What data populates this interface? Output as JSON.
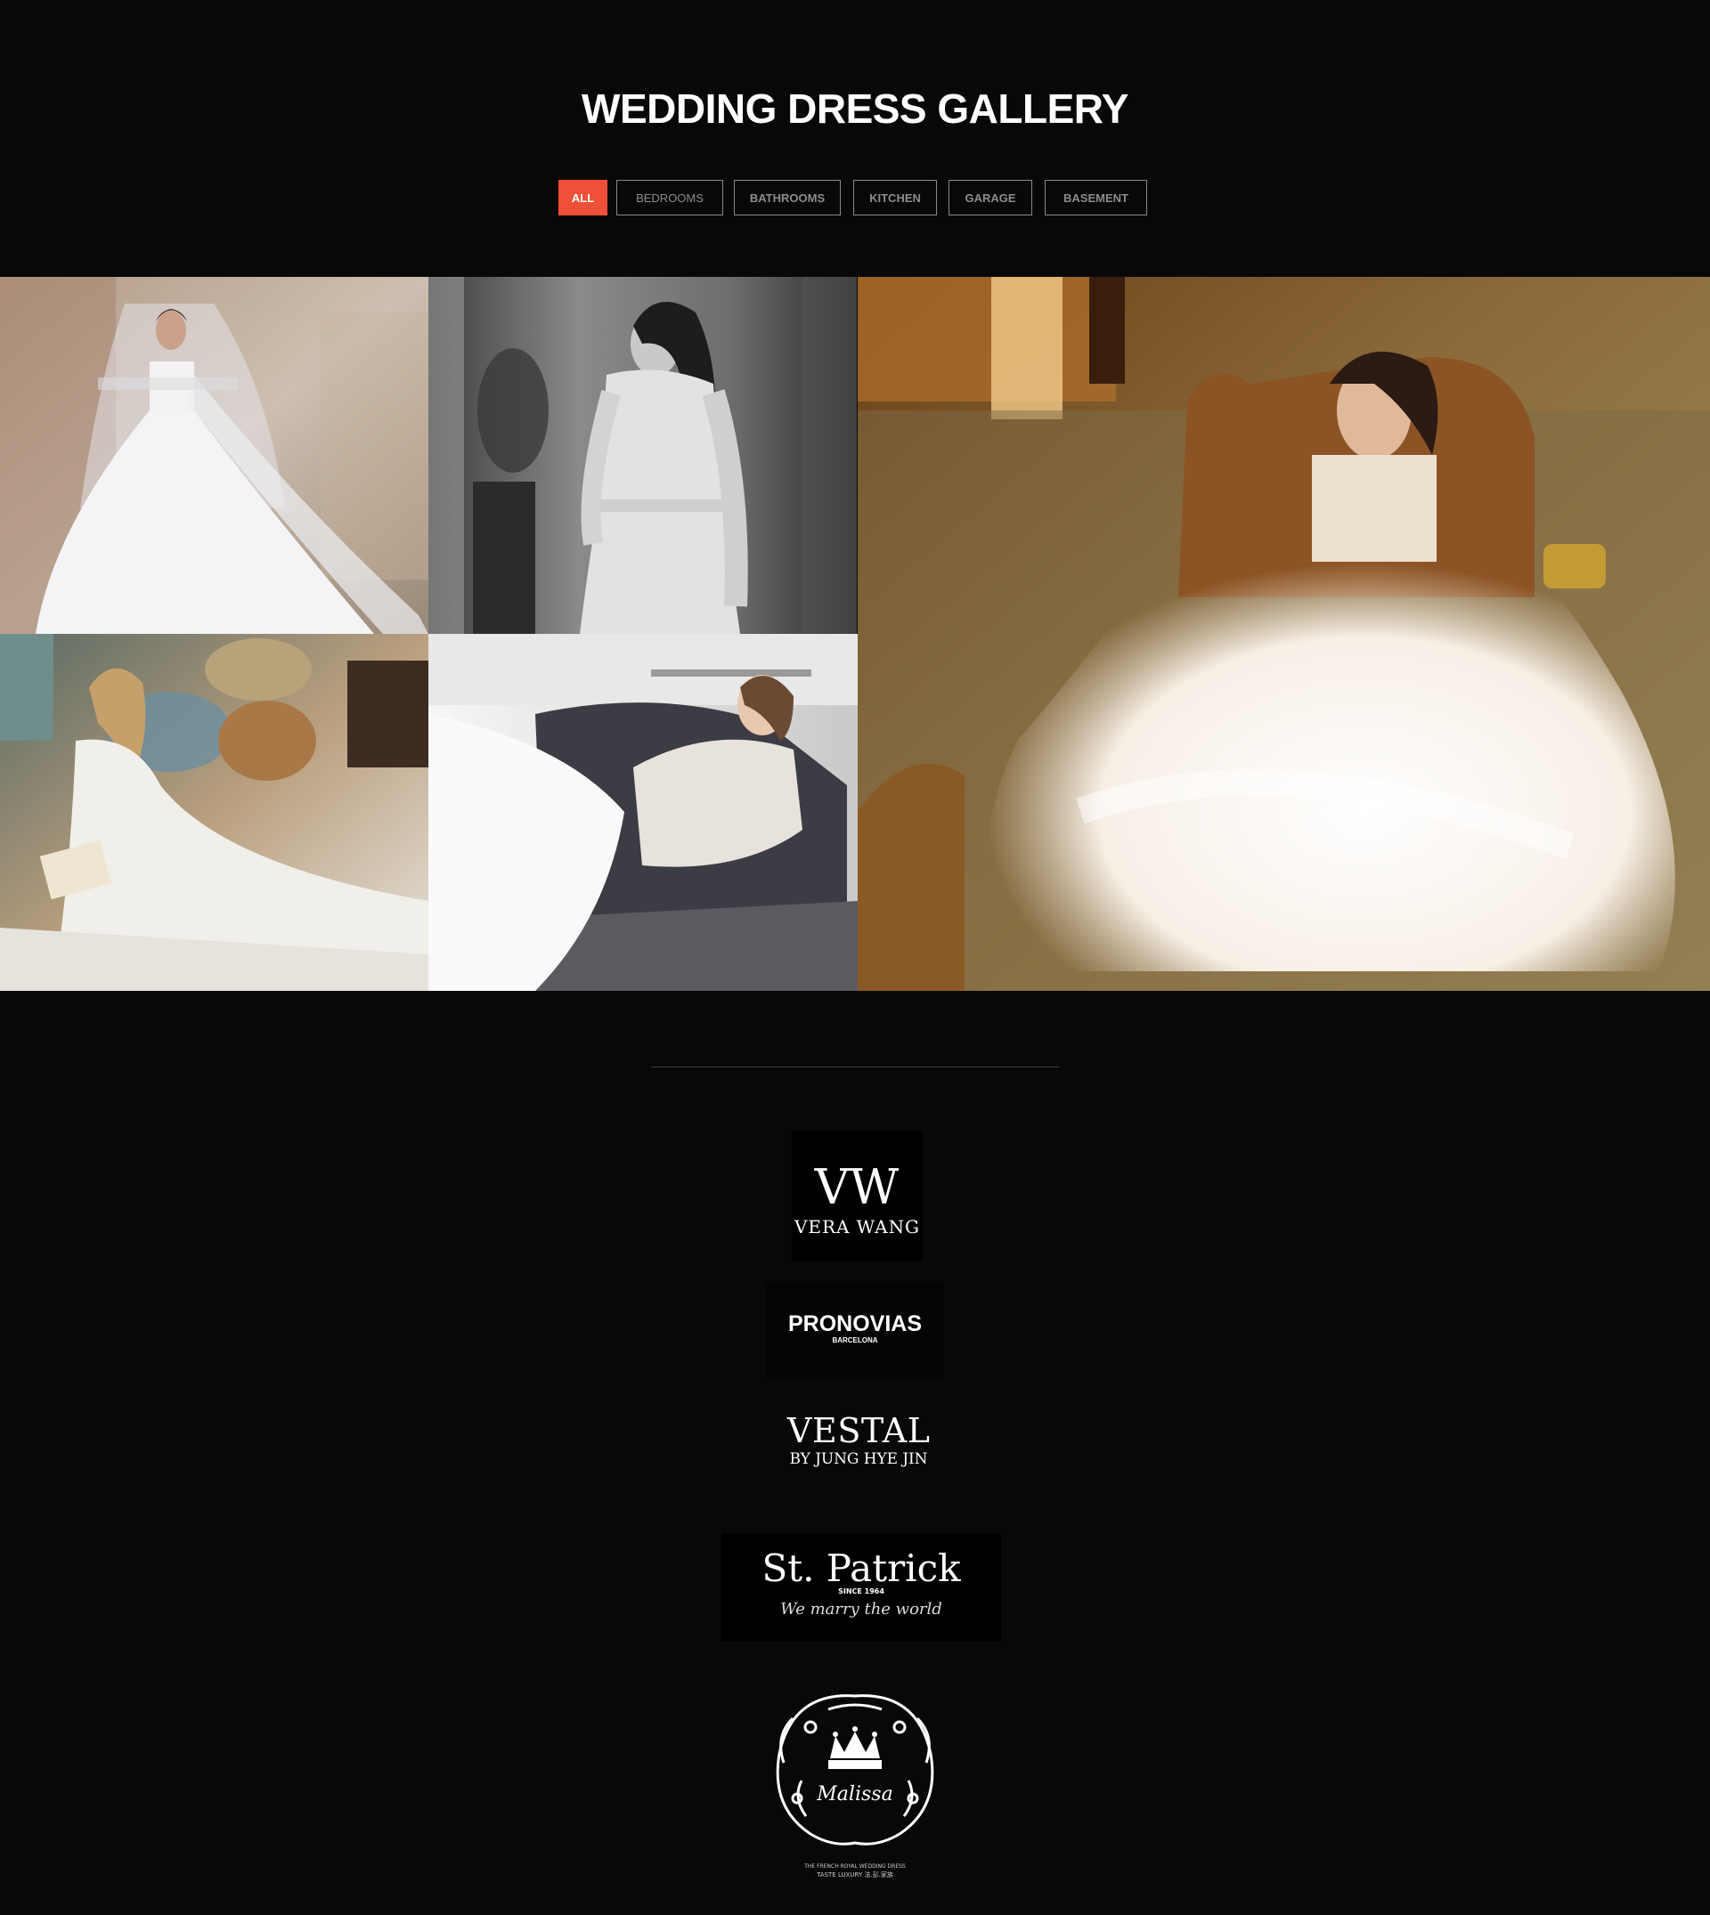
{
  "header": {
    "title": "WEDDING DRESS GALLERY"
  },
  "filters": [
    {
      "label": "ALL",
      "active": true
    },
    {
      "label": "BEDROOMS",
      "active": false
    },
    {
      "label": "BATHROOMS",
      "active": false
    },
    {
      "label": "KITCHEN",
      "active": false
    },
    {
      "label": "GARAGE",
      "active": false
    },
    {
      "label": "BASEMENT",
      "active": false
    }
  ],
  "colors": {
    "background": "#080809",
    "accent": "#ef5037",
    "filter_border": "#8a8a8a"
  },
  "brands": {
    "vera_wang": {
      "name": "VERA WANG",
      "mark": "VW"
    },
    "pronovias": {
      "name": "PRONOVIAS",
      "sub": "BARCELONA"
    },
    "vestal": {
      "name": "VESTAL",
      "sub": "BY JUNG HYE JIN"
    },
    "st_patrick": {
      "name": "St. Patrick",
      "since": "SINCE 1964",
      "tagline": "We marry the world"
    },
    "malissa": {
      "name": "Malissa",
      "line1": "THE FRENCH ROYAL WEDDING DRESS",
      "line2": "TASTE LUXURY 法.彭.家族"
    }
  }
}
